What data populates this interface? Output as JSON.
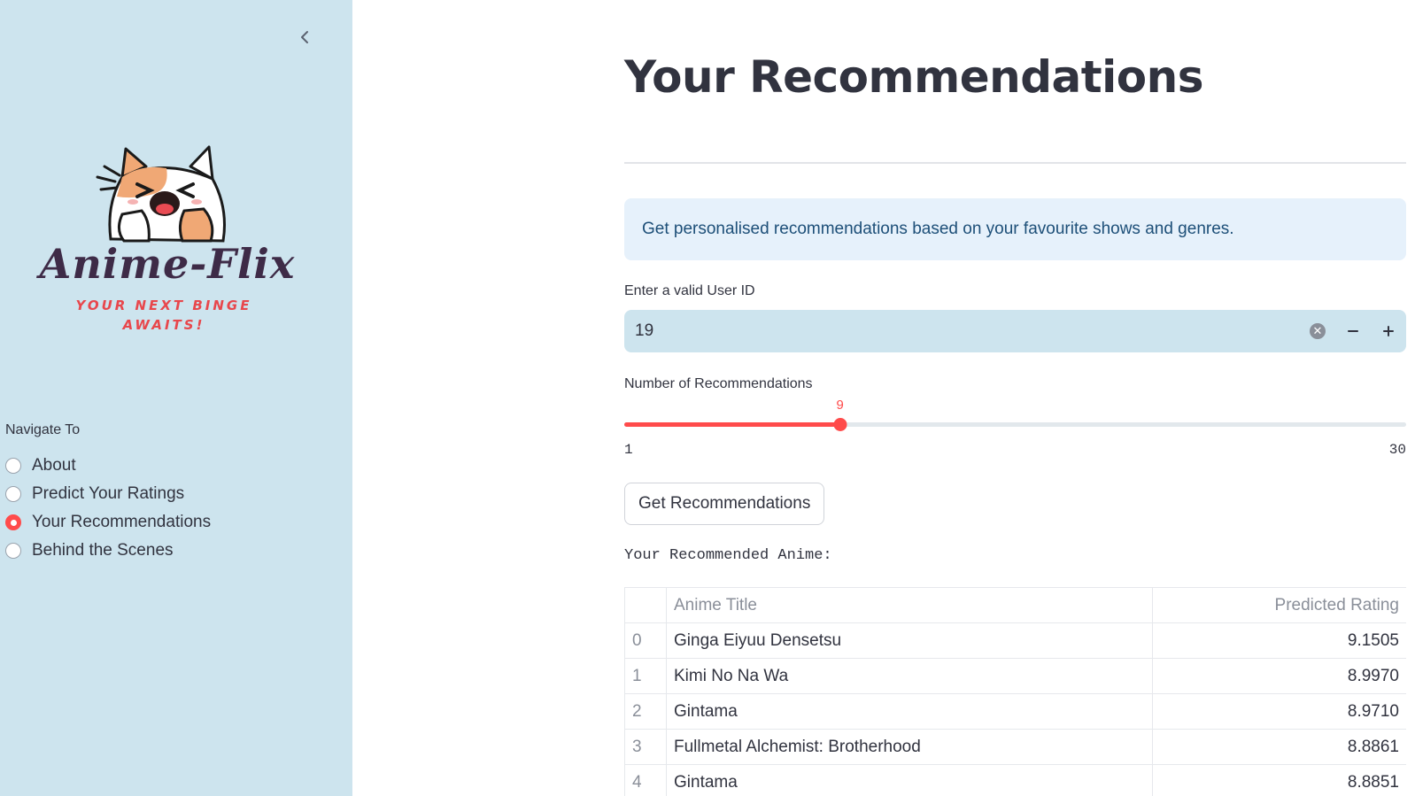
{
  "sidebar": {
    "logo_title": "Anime-Flix",
    "logo_tagline": "YOUR NEXT BINGE AWAITS!",
    "nav_label": "Navigate To",
    "nav_items": [
      {
        "label": "About",
        "selected": false
      },
      {
        "label": "Predict Your Ratings",
        "selected": false
      },
      {
        "label": "Your Recommendations",
        "selected": true
      },
      {
        "label": "Behind the Scenes",
        "selected": false
      }
    ]
  },
  "main": {
    "title": "Your Recommendations",
    "info": "Get personalised recommendations based on your favourite shows and genres.",
    "user_id": {
      "label": "Enter a valid User ID",
      "value": "19"
    },
    "slider": {
      "label": "Number of Recommendations",
      "value": 9,
      "min": 1,
      "max": 30
    },
    "button_label": "Get Recommendations",
    "result_label": "Your Recommended Anime:",
    "table": {
      "headers": [
        "",
        "Anime Title",
        "Predicted Rating"
      ],
      "rows": [
        {
          "index": "0",
          "title": "Ginga Eiyuu Densetsu",
          "rating": "9.1505"
        },
        {
          "index": "1",
          "title": "Kimi No Na Wa",
          "rating": "8.9970"
        },
        {
          "index": "2",
          "title": "Gintama",
          "rating": "8.9710"
        },
        {
          "index": "3",
          "title": "Fullmetal Alchemist: Brotherhood",
          "rating": "8.8861"
        },
        {
          "index": "4",
          "title": "Gintama",
          "rating": "8.8851"
        }
      ]
    }
  },
  "colors": {
    "sidebar_bg": "#cde4ee",
    "accent": "#ff4b4b",
    "info_bg": "#e6f1fb",
    "text": "#31333f"
  },
  "icons": {
    "collapse": "chevron-left-icon",
    "clear": "clear-icon",
    "decrement": "minus-icon",
    "increment": "plus-icon"
  }
}
